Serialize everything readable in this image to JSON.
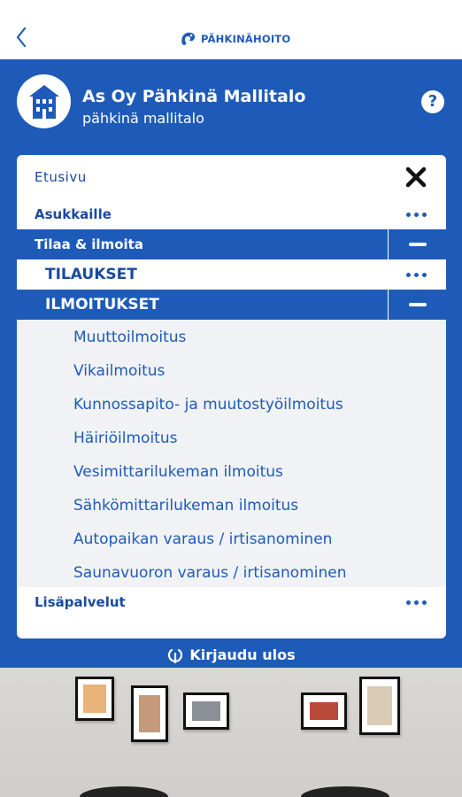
{
  "header": {
    "back_icon": "chevron-left-icon",
    "logo_text": "PÄHKINÄHOITO",
    "brand_color": "#1e5bb8"
  },
  "company": {
    "name": "As Oy Pähkinä Mallitalo",
    "subtitle": "pähkinä mallitalo",
    "help_symbol": "?"
  },
  "menu": {
    "items": [
      {
        "label": "Etusivu",
        "icon": "close-icon"
      },
      {
        "label": "Asukkaille",
        "icon": "more-icon"
      },
      {
        "label": "Tilaa & ilmoita",
        "icon": "minus-icon",
        "active": true
      },
      {
        "label": "TILAUKSET",
        "icon": "more-icon"
      },
      {
        "label": "ILMOITUKSET",
        "icon": "minus-icon",
        "active": true
      },
      {
        "label": "Lisäpalvelut",
        "icon": "more-icon"
      }
    ],
    "subitems": [
      "Muuttoilmoitus",
      "Vikailmoitus",
      "Kunnossapito- ja muutostyöilmoitus",
      "Häiriöilmoitus",
      "Vesimittarilukeman ilmoitus",
      "Sähkömittarilukeman ilmoitus",
      "Autopaikan varaus / irtisanominen",
      "Saunavuoron varaus / irtisanominen"
    ]
  },
  "logout": {
    "label": "Kirjaudu ulos",
    "icon": "power-icon"
  }
}
